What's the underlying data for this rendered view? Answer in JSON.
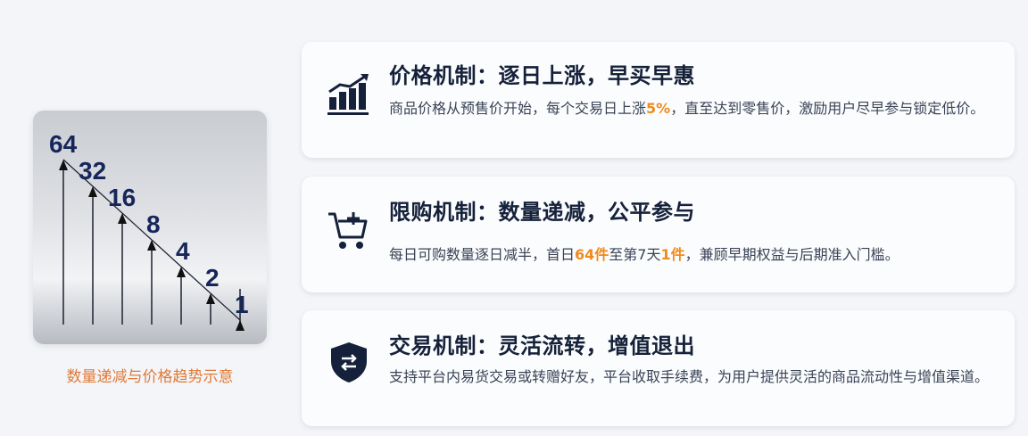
{
  "illustration": {
    "numbers": [
      "64",
      "32",
      "16",
      "8",
      "4",
      "2",
      "1"
    ],
    "caption": "数量递减与价格趋势示意"
  },
  "cards": [
    {
      "icon": "rising-bar-chart-icon",
      "title": "价格机制：逐日上涨，早买早惠",
      "desc_pre": "商品价格从预售价开始，每个交易日上涨",
      "desc_hl1": "5%",
      "desc_mid": "，直至达到零售价，激励用户尽早参与锁定低价。",
      "desc_hl2": "",
      "desc_post": ""
    },
    {
      "icon": "shopping-cart-add-icon",
      "title": "限购机制：数量递减，公平参与",
      "desc_pre": "每日可购数量逐日减半，首日",
      "desc_hl1": "64件",
      "desc_mid": "至第7天",
      "desc_hl2": "1件",
      "desc_post": "，兼顾早期权益与后期准入门槛。"
    },
    {
      "icon": "shield-exchange-icon",
      "title": "交易机制：灵活流转，增值退出",
      "desc_pre": "支持平台内易货交易或转赠好友，平台收取手续费，为用户提供灵活的商品流动性与增值渠道。",
      "desc_hl1": "",
      "desc_mid": "",
      "desc_hl2": "",
      "desc_post": ""
    }
  ],
  "colors": {
    "accent": "#f08a1c",
    "navy": "#15213a",
    "caption": "#e07a38"
  }
}
